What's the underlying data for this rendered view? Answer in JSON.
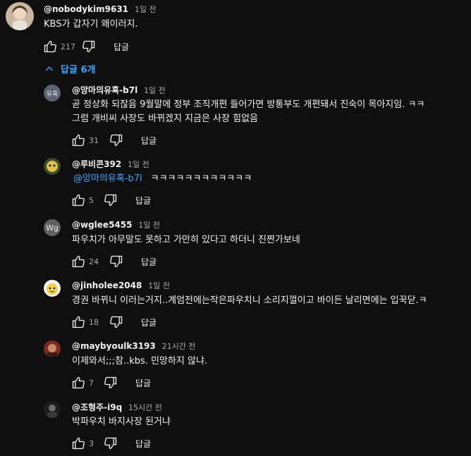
{
  "top_comment": {
    "author": "@nobodykim9631",
    "time": "1일 전",
    "text": "KBS가 갑자기 왜이러지.",
    "likes": "217",
    "reply_label": "답글"
  },
  "replies_toggle": {
    "label": "답글 6개"
  },
  "replies": [
    {
      "author": "@앙마의유혹-b7l",
      "time": "1일 전",
      "avatar_text": "유혹",
      "lines": [
        "곧 정상화 되잖음 9월말에 정부 조직개편 들어가면 방통부도 개편돼서 진숙이 목아지임. ㅋㅋ",
        "그럼 개비씨 사장도 바뀌겠지 지금은 사장 힘없음"
      ],
      "likes": "31",
      "reply_label": "답글"
    },
    {
      "author": "@루비콘392",
      "time": "1일 전",
      "mention": "@앙마의유혹-b7l",
      "lines": [
        "ㅋㅋㅋㅋㅋㅋㅋㅋㅋㅋㅋㅋ"
      ],
      "likes": "5",
      "reply_label": "답글"
    },
    {
      "author": "@wglee5455",
      "time": "1일 전",
      "avatar_text": "Wg",
      "lines": [
        "파우치가 아무말도 못하고 가만히 있다고 하더니 진짠가보네"
      ],
      "likes": "24",
      "reply_label": "답글"
    },
    {
      "author": "@jinholee2048",
      "time": "1일 전",
      "lines": [
        "경권 바뀌니 이러는거지..계엄전에는작은파우치니 소리지껄이고 바이든 날리면에는 입꾹닫.ㅋ"
      ],
      "likes": "18",
      "reply_label": "답글"
    },
    {
      "author": "@maybyoulk3193",
      "time": "21시간 전",
      "lines": [
        "이제와서;;;참..kbs. 민망하지 않냐."
      ],
      "likes": "7",
      "reply_label": "답글"
    },
    {
      "author": "@조형주-i9q",
      "time": "15시간 전",
      "lines": [
        "박파우치 바지사장 된거냐"
      ],
      "likes": "3",
      "reply_label": "답글"
    }
  ],
  "colors": {
    "background": "#0f0f0f",
    "text": "#f1f1f1",
    "secondary": "#aaaaaa",
    "link": "#3ea6ff"
  }
}
